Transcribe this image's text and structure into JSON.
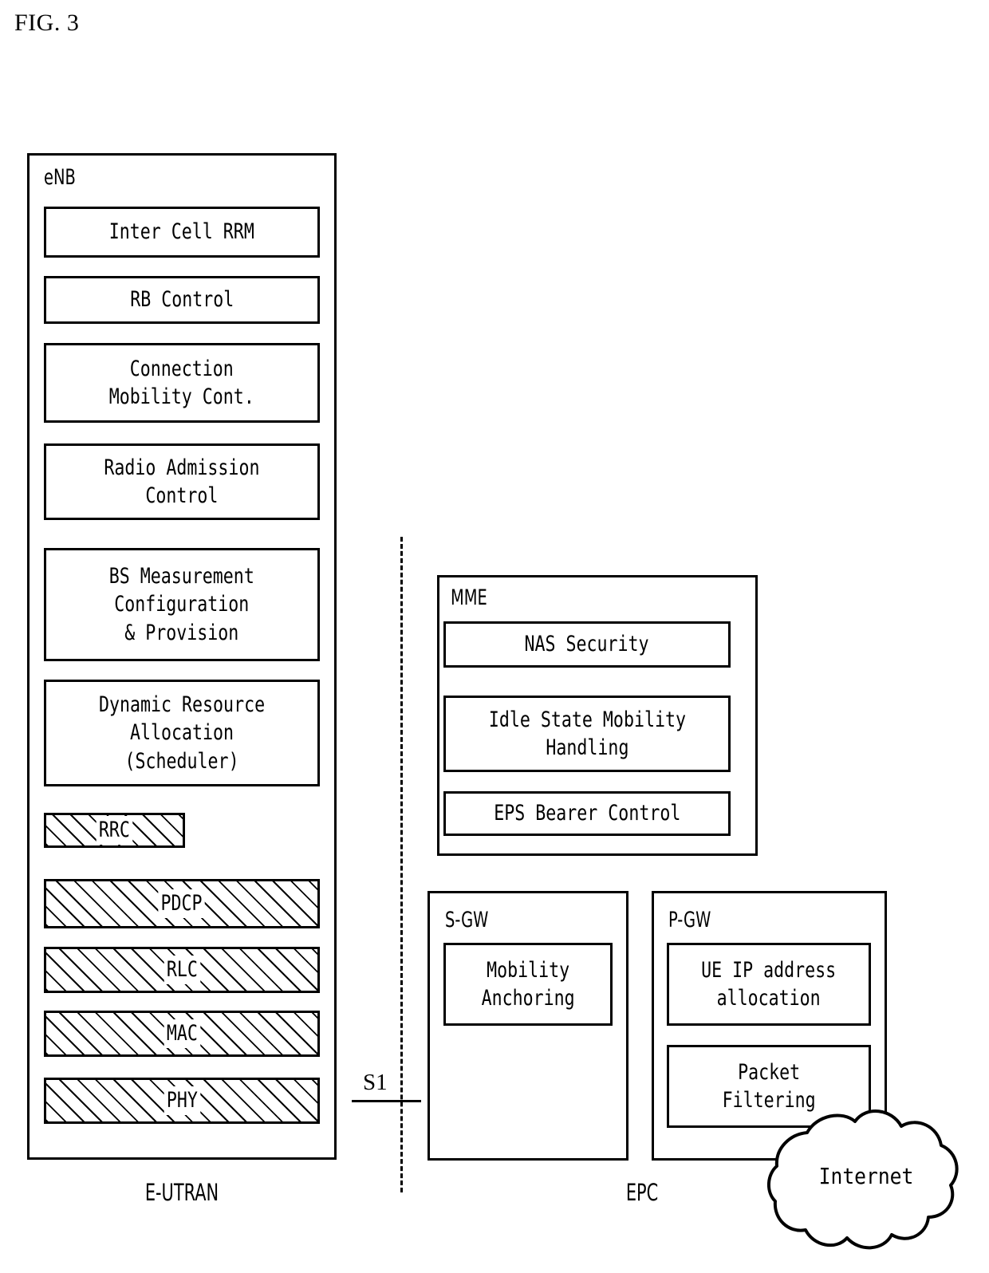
{
  "figure": {
    "title": "FIG. 3"
  },
  "enb": {
    "label": "eNB",
    "caption": "E-UTRAN",
    "functions": [
      {
        "label": "Inter Cell RRM",
        "hatched": false
      },
      {
        "label": "RB Control",
        "hatched": false
      },
      {
        "label": "Connection\nMobility Cont.",
        "hatched": false
      },
      {
        "label": "Radio Admission\nControl",
        "hatched": false
      },
      {
        "label": "BS Measurement\nConfiguration\n& Provision",
        "hatched": false
      },
      {
        "label": "Dynamic Resource\nAllocation\n(Scheduler)",
        "hatched": false
      },
      {
        "label": "RRC",
        "hatched": true
      },
      {
        "label": "PDCP",
        "hatched": true
      },
      {
        "label": "RLC",
        "hatched": true
      },
      {
        "label": "MAC",
        "hatched": true
      },
      {
        "label": "PHY",
        "hatched": true
      }
    ]
  },
  "epc": {
    "caption": "EPC",
    "mme": {
      "label": "MME",
      "functions": [
        {
          "label": "NAS Security"
        },
        {
          "label": "Idle State Mobility\nHandling"
        },
        {
          "label": "EPS Bearer Control"
        }
      ]
    },
    "sgw": {
      "label": "S-GW",
      "functions": [
        {
          "label": "Mobility\nAnchoring"
        }
      ]
    },
    "pgw": {
      "label": "P-GW",
      "functions": [
        {
          "label": "UE IP address\nallocation"
        },
        {
          "label": "Packet\nFiltering"
        }
      ]
    }
  },
  "interface": {
    "s1_label": "S1"
  },
  "internet": {
    "label": "Internet"
  },
  "colors": {
    "line": "#000000",
    "background": "#ffffff"
  }
}
